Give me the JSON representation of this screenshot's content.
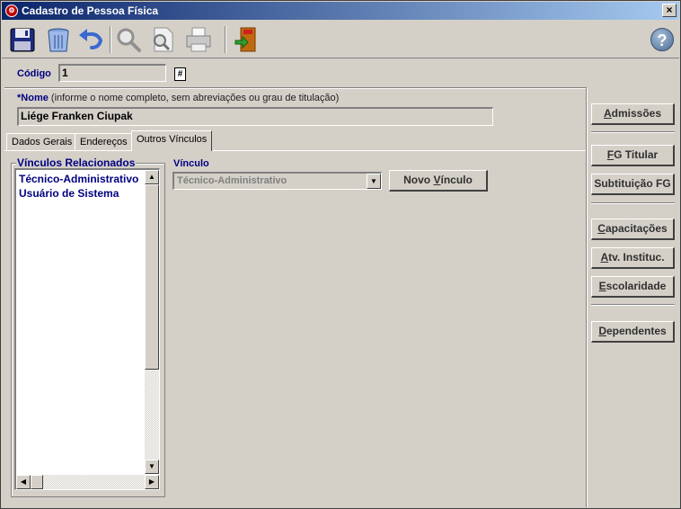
{
  "window": {
    "title": "Cadastro de Pessoa Física",
    "close_glyph": "×",
    "app_icon": "app-logo-icon"
  },
  "toolbar": {
    "buttons": [
      {
        "icon": "save-icon"
      },
      {
        "icon": "delete-icon"
      },
      {
        "icon": "undo-icon"
      },
      {
        "icon": "search-icon"
      },
      {
        "icon": "find-document-icon"
      },
      {
        "icon": "print-icon"
      },
      {
        "icon": "exit-icon"
      }
    ],
    "help_glyph": "?"
  },
  "codigo": {
    "label": "Código",
    "value": "1"
  },
  "nome": {
    "required_mark": "*",
    "label": "Nome",
    "hint": "(informe o nome completo, sem abreviações ou grau de titulação)",
    "value": "Liége Franken Ciupak"
  },
  "tabs": [
    {
      "label": "Dados Gerais",
      "active": false
    },
    {
      "label": "Endereços",
      "active": false
    },
    {
      "label": "Outros Vínculos",
      "active": true
    }
  ],
  "vinculos": {
    "title": "Vínculos Relacionados",
    "items": [
      "Técnico-Administrativo",
      "Usuário de Sistema"
    ]
  },
  "vinculo": {
    "label": "Vínculo",
    "selected": "Técnico-Administrativo",
    "novo_prefix": "Novo ",
    "novo_underlined": "V",
    "novo_suffix": "ínculo"
  },
  "sidebar": {
    "admissoes": {
      "u": "A",
      "rest": "dmissões"
    },
    "fg_titular": {
      "u": "F",
      "rest": "G Titular"
    },
    "subtituicao_fg": {
      "u": "",
      "rest": "Subtituição FG"
    },
    "capacitacoes": {
      "u": "C",
      "rest": "apacitações"
    },
    "atv_instituc": {
      "u": "A",
      "rest": "tv. Instituc."
    },
    "escolaridade": {
      "u": "E",
      "rest": "scolaridade"
    },
    "dependentes": {
      "u": "D",
      "rest": "ependentes"
    }
  },
  "colors": {
    "title_start": "#0a246a",
    "title_end": "#a6caf0",
    "label_blue": "#000080",
    "face": "#d4d0c8"
  }
}
